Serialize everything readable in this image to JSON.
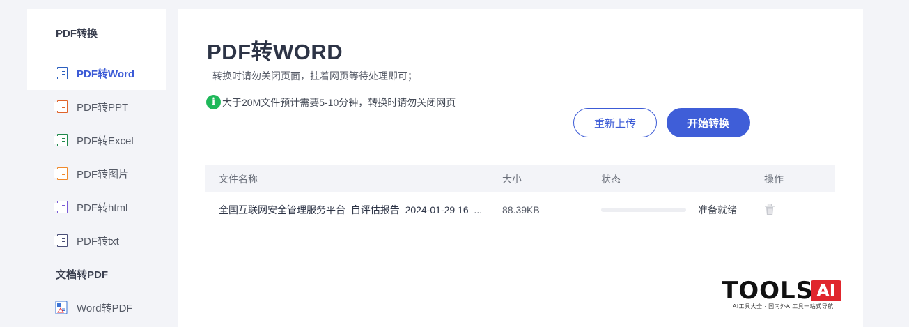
{
  "sidebar": {
    "group1": "PDF转换",
    "items": [
      {
        "label": "PDF转Word",
        "tag": "W",
        "color": "#2b5fbf",
        "active": true
      },
      {
        "label": "PDF转PPT",
        "tag": "P",
        "color": "#e0632a"
      },
      {
        "label": "PDF转Excel",
        "tag": "X",
        "color": "#1f8a4c"
      },
      {
        "label": "PDF转图片",
        "tag": "▲",
        "color": "#f08a2c"
      },
      {
        "label": "PDF转html",
        "tag": "H",
        "color": "#7a5ad6"
      },
      {
        "label": "PDF转txt",
        "tag": "T",
        "color": "#4a4f78"
      }
    ],
    "group2": "文档转PDF",
    "items2": [
      {
        "label": "Word转PDF",
        "color": "#3a73d6"
      }
    ]
  },
  "main": {
    "title": "PDF转WORD",
    "subtitle": "转换时请勿关闭页面，挂着网页等待处理即可；",
    "notice": "大于20M文件预计需要5-10分钟，转换时请勿关闭网页",
    "reupload_label": "重新上传",
    "start_label": "开始转换",
    "accent": "#3f5ed8"
  },
  "table": {
    "headers": {
      "name": "文件名称",
      "size": "大小",
      "status": "状态",
      "action": "操作"
    },
    "rows": [
      {
        "name": "全国互联网安全管理服务平台_自评估报告_2024-01-29 16_...",
        "size": "88.39KB",
        "progress": 0,
        "status": "准备就绪"
      }
    ]
  },
  "logo": {
    "text": "TOOLS",
    "badge": "AI",
    "sub": "AI工具大全 · 国内外AI工具一站式导航"
  }
}
